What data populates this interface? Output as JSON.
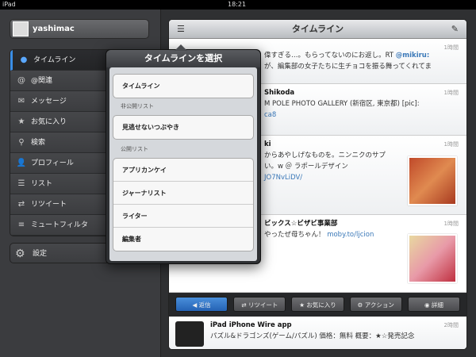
{
  "status": {
    "device": "iPad",
    "time": "18:21"
  },
  "sidebar": {
    "username": "yashimac",
    "items": [
      {
        "label": "タイムライン",
        "icon": "speech-bubble-icon"
      },
      {
        "label": "@関連",
        "icon": "at-icon"
      },
      {
        "label": "メッセージ",
        "icon": "envelope-icon"
      },
      {
        "label": "お気に入り",
        "icon": "star-icon"
      },
      {
        "label": "検索",
        "icon": "search-icon"
      },
      {
        "label": "プロフィール",
        "icon": "person-icon"
      },
      {
        "label": "リスト",
        "icon": "list-icon"
      },
      {
        "label": "リツイート",
        "icon": "retweet-icon"
      },
      {
        "label": "ミュートフィルタ",
        "icon": "filter-icon"
      }
    ],
    "settings": "設定"
  },
  "header": {
    "title": "タイムライン"
  },
  "tweets": [
    {
      "text": "偉すぎる…。もらってないのにお返し。RT ",
      "mention": "@mikiru:",
      "text2": "が、編集部の女子たちに生チョコを振る舞ってくれてま",
      "time": "1時間"
    },
    {
      "name": "Shikoda",
      "text": "M POLE PHOTO GALLERY (新宿区, 東京都) [pic]:",
      "link": "ca8",
      "time": "1時間"
    },
    {
      "name": "ki",
      "text": "からあやしげなものを。ニンニクのサプ",
      "text2": "い。w ＠ ラポールデザイン",
      "link": "JO7NvLiDV/",
      "time": "1時間"
    },
    {
      "name": "ビックス☆ビザビ事業部",
      "text": "やったぜ母ちゃん！ ",
      "link": "moby.to/ljcion",
      "time": "1時間"
    },
    {
      "name": "iPad iPhone Wire app",
      "text": "パズル&ドラゴンズ(ゲーム/パズル) 価格：無料 概要：★☆発売記念",
      "time": "2時間"
    }
  ],
  "toolbar": {
    "reply": "返信",
    "retweet": "リツイート",
    "favorite": "お気に入り",
    "action": "アクション",
    "detail": "詳細"
  },
  "popover": {
    "title": "タイムラインを選択",
    "timeline": "タイムライン",
    "private_header": "非公開リスト",
    "private": [
      "見逃せないつぶやき"
    ],
    "public_header": "公開リスト",
    "public": [
      "アプリカンケイ",
      "ジャーナリスト",
      "ライター",
      "編集者"
    ]
  },
  "colors": {
    "accent": "#3a8ee6",
    "reply_button": "#2f72c4"
  }
}
